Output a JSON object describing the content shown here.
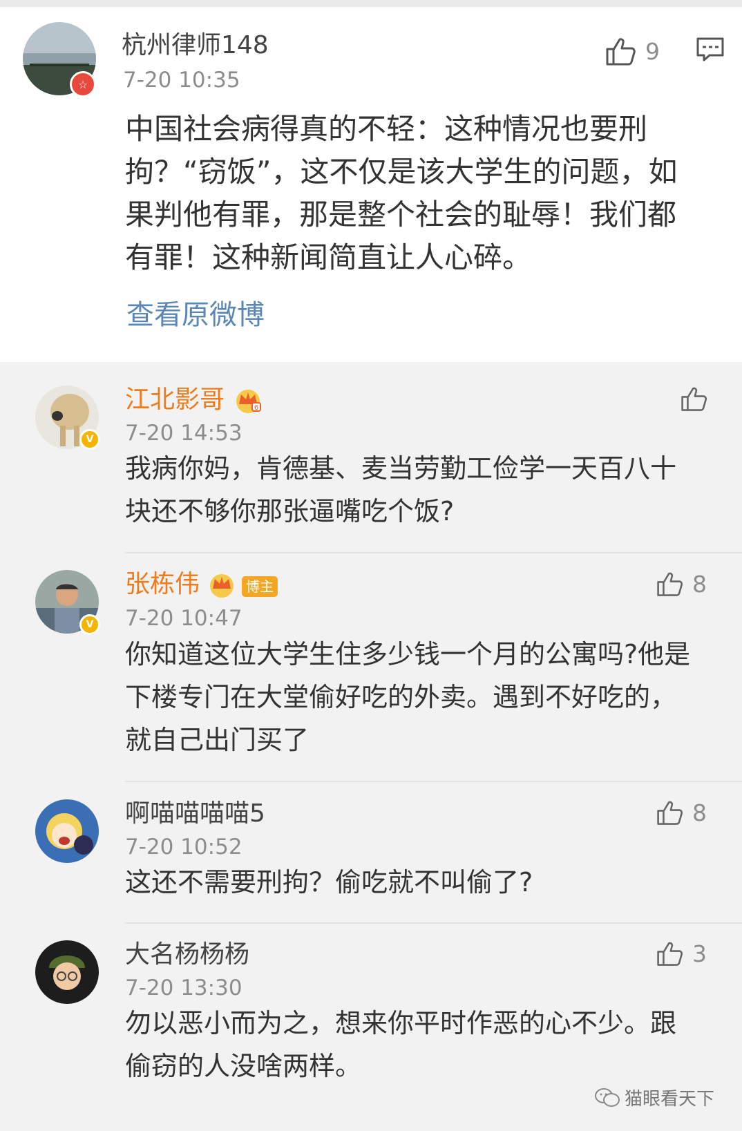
{
  "main_post": {
    "username": "杭州律师148",
    "timestamp": "7-20 10:35",
    "like_count": "9",
    "text": "中国社会病得真的不轻：这种情况也要刑拘？“窃饭”，这不仅是该大学生的问题，如果判他有罪，那是整个社会的耻辱！我们都有罪！这种新闻简直让人心碎。",
    "view_original_link": "查看原微博"
  },
  "replies": [
    {
      "username": "江北影哥",
      "timestamp": "7-20 14:53",
      "like_count": "",
      "text": "我病你妈，肯德基、麦当劳勤工俭学一天百八十块还不够你那张逼嘴吃个饭?"
    },
    {
      "username": "张栋伟",
      "tag": "博主",
      "timestamp": "7-20 10:47",
      "like_count": "8",
      "text": "你知道这位大学生住多少钱一个月的公寓吗?他是下楼专门在大堂偷好吃的外卖。遇到不好吃的，就自己出门买了"
    },
    {
      "username": "啊喵喵喵喵5",
      "timestamp": "7-20 10:52",
      "like_count": "8",
      "text": "这还不需要刑拘？偷吃就不叫偷了?"
    },
    {
      "username": "大名杨杨杨",
      "timestamp": "7-20 13:30",
      "like_count": "3",
      "text": "勿以恶小而为之，想来你平时作恶的心不少。跟偷窃的人没啥两样。"
    }
  ],
  "watermark": "猫眼看天下",
  "colors": {
    "vip_name": "#ef7b1c",
    "link": "#5b87b6",
    "timestamp": "#8c8c8c",
    "tag_boshu": "#f5a623"
  }
}
